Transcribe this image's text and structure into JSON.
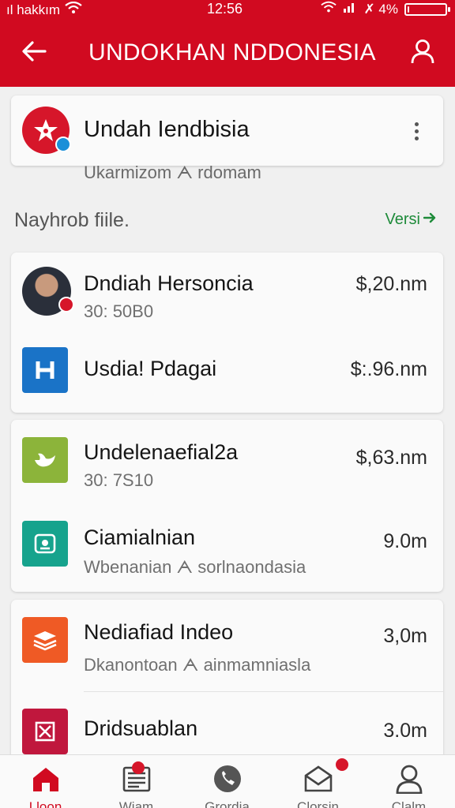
{
  "status_bar": {
    "carrier": "ıl hakkım",
    "time": "12:56",
    "battery": "✗ 4%",
    "battery_level": 0.04
  },
  "app_bar": {
    "title": "UNDOKHAN NDDONESIA",
    "back_icon": "arrow-left-icon",
    "profile_icon": "person-icon"
  },
  "brand": {
    "name": "Undah Iendbisia",
    "subtitle": "Ukarmizom  ᗅ rdomam",
    "logo_icon": "star-logo-icon",
    "more_icon": "more-vertical-icon"
  },
  "section": {
    "title": "Nayhrob fiile.",
    "link": "Versi"
  },
  "cards": [
    {
      "rows": [
        {
          "name": "Dndiah Hersoncia",
          "sub": "30: 50B0",
          "amount": "$,20.nm",
          "icon": "avatar"
        },
        {
          "name": "Usdia! Pdagai",
          "sub": "",
          "amount": "$:.96.nm",
          "icon": "h-app-icon"
        }
      ]
    },
    {
      "rows": [
        {
          "name": "Undelenaefial2a",
          "sub": "30: 7S10",
          "amount": "$,63.nm",
          "icon": "bird-app-icon"
        },
        {
          "name": "Ciamialnian",
          "sub": "Wbenanian  ᗅ sorlnaondasia",
          "amount": "9.0m",
          "icon": "teal-app-icon"
        }
      ]
    },
    {
      "rows": [
        {
          "name": "Nediafiad  Indeo",
          "sub": "Dkanontoan  ᗅ ainmamniasla",
          "amount": "3,0m",
          "icon": "orange-app-icon"
        },
        {
          "name": "Dridsuablan",
          "sub": "",
          "amount": "3.0m",
          "icon": "crimson-app-icon"
        }
      ]
    }
  ],
  "bottom_nav": [
    {
      "label": "Lloon",
      "icon": "home-icon",
      "active": true
    },
    {
      "label": "Wiam",
      "icon": "newspaper-icon",
      "active": false
    },
    {
      "label": "Grordia",
      "icon": "phone-icon",
      "active": false
    },
    {
      "label": "Clorsin",
      "icon": "mail-open-icon",
      "active": false
    },
    {
      "label": "Clalm",
      "icon": "person-icon",
      "active": false
    }
  ],
  "colors": {
    "brand_red": "#d10a20",
    "link_green": "#1e8b3a",
    "h_blue": "#1a73c7",
    "bird_green": "#8cb43a",
    "teal": "#16a38d",
    "orange": "#ef5a25",
    "crimson": "#c0173d"
  }
}
